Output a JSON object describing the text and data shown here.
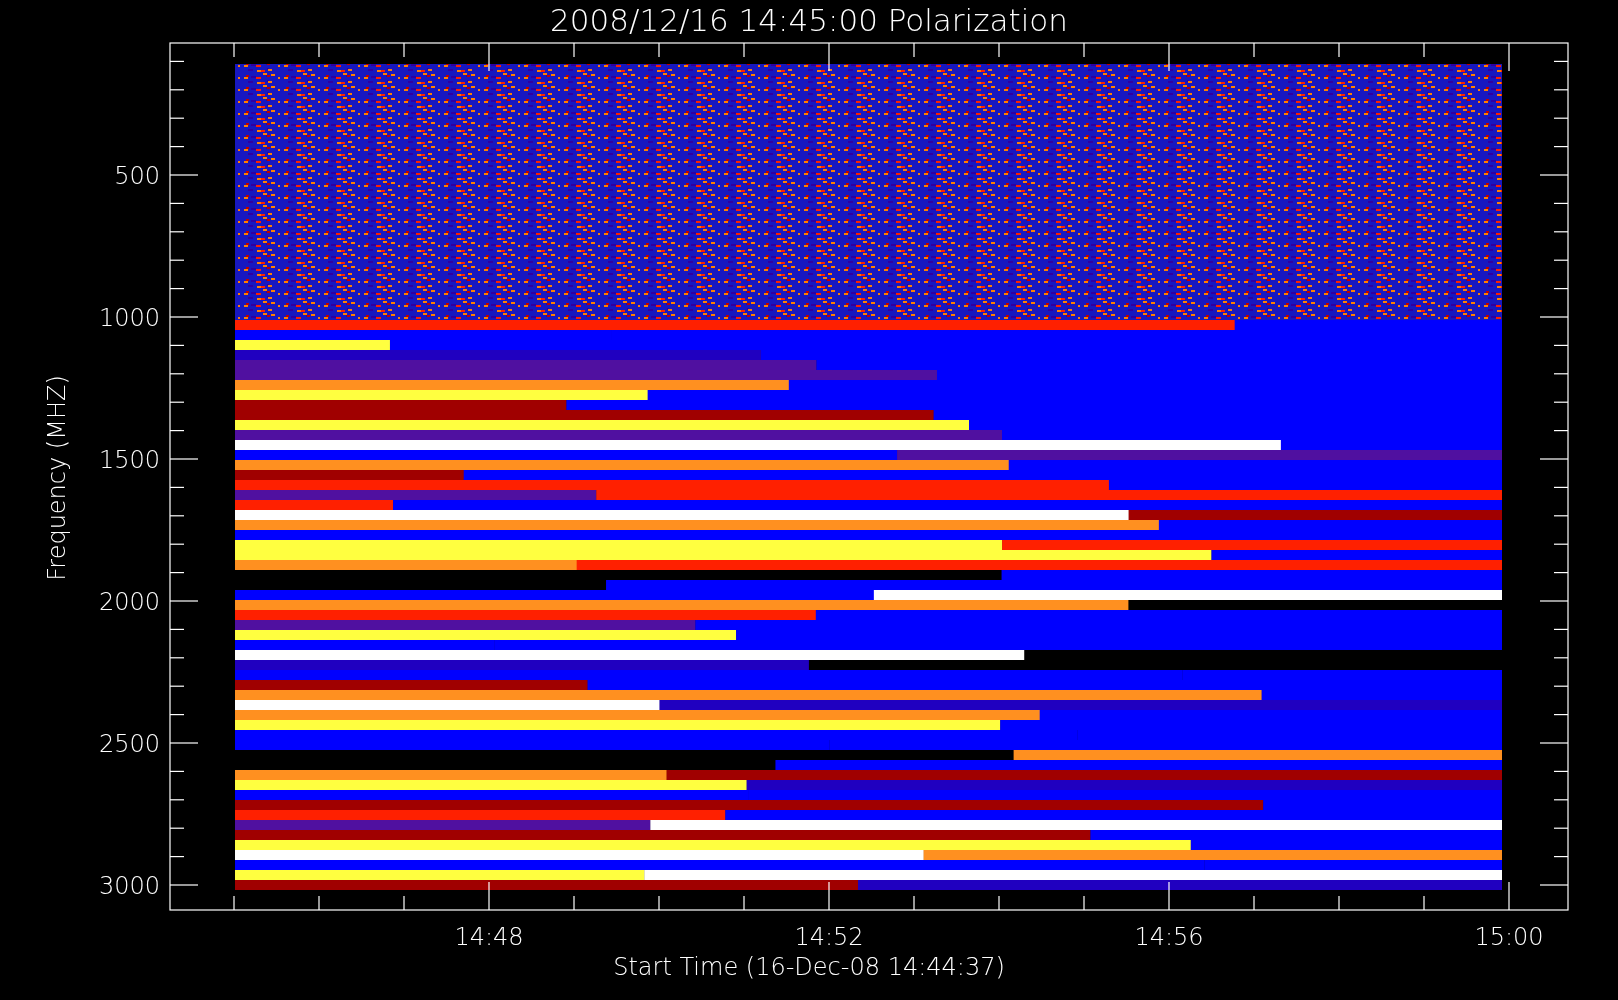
{
  "title": "2008/12/16 14:45:00 Polarization",
  "y_axis": {
    "label": "Frequency (MHZ)",
    "ticks": [
      "500",
      "1000",
      "1500",
      "2000",
      "2500",
      "3000"
    ]
  },
  "x_axis": {
    "label": "Start Time (16-Dec-08 14:44:37)",
    "ticks": [
      "14:48",
      "14:52",
      "14:56",
      "15:00"
    ]
  }
}
